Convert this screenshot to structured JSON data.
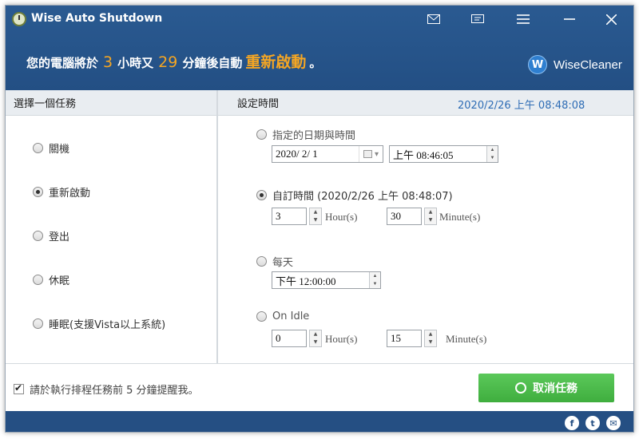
{
  "window": {
    "title": "Wise Auto Shutdown",
    "title_icons": [
      "mail-icon",
      "feedback-icon",
      "menu-icon",
      "minimize-icon",
      "close-icon"
    ]
  },
  "countdown": {
    "prefix": "您的電腦將於",
    "hours": "3",
    "mid1": "小時又",
    "minutes": "29",
    "mid2": "分鐘後自動",
    "action": "重新啟動",
    "suffix": "。"
  },
  "brand": {
    "logo": "W",
    "name": "WiseCleaner"
  },
  "left_panel": {
    "header": "選擇一個任務",
    "tasks": [
      {
        "label": "關機",
        "checked": false
      },
      {
        "label": "重新啟動",
        "checked": true
      },
      {
        "label": "登出",
        "checked": false
      },
      {
        "label": "休眠",
        "checked": false
      },
      {
        "label": "睡眠(支援Vista以上系統)",
        "checked": false
      }
    ]
  },
  "right_panel": {
    "header": "設定時間",
    "current_time": "2020/2/26 上午 08:48:08",
    "specific": {
      "label": "指定的日期與時間",
      "date": "2020/ 2/ 1",
      "time": "上午 08:46:05"
    },
    "custom": {
      "label": "自訂時間 (2020/2/26 上午 08:48:07)",
      "hours": "3",
      "hours_unit": "Hour(s)",
      "minutes": "30",
      "minutes_unit": "Minute(s)"
    },
    "daily": {
      "label": "每天",
      "time": "下午 12:00:00"
    },
    "idle": {
      "label": "On Idle",
      "hours": "0",
      "hours_unit": "Hour(s)",
      "minutes": "15",
      "minutes_unit": "Minute(s)"
    }
  },
  "footer": {
    "reminder": "請於執行排程任務前 5 分鐘提醒我。",
    "cancel_button": "取消任務",
    "social": [
      "f",
      "t",
      "✉"
    ]
  },
  "colors": {
    "header_bg": "#234f84",
    "accent_orange": "#f5a623",
    "button_green": "#4cbb4b",
    "time_blue": "#2d6cb5"
  }
}
